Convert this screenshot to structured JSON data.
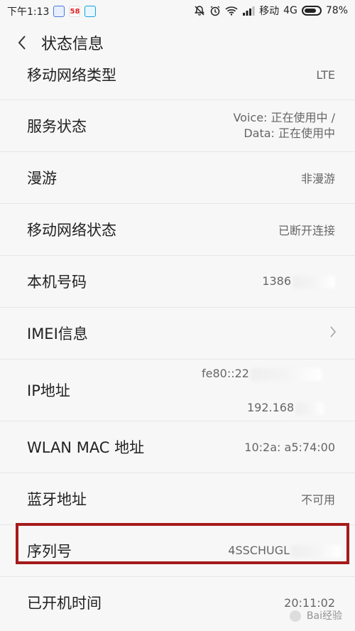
{
  "status_bar": {
    "time": "下午1:13",
    "app_badge": "58",
    "carrier": "移动",
    "network": "4G",
    "battery_percent": "78%",
    "battery_level": 0.78
  },
  "header": {
    "title": "状态信息"
  },
  "rows": [
    {
      "label": "移动网络类型",
      "value": "LTE"
    },
    {
      "label": "服务状态",
      "value_line1": "Voice: 正在使用中 /",
      "value_line2": "Data: 正在使用中"
    },
    {
      "label": "漫游",
      "value": "非漫游"
    },
    {
      "label": "移动网络状态",
      "value": "已断开连接"
    },
    {
      "label": "本机号码",
      "value": "1386"
    },
    {
      "label": "IMEI信息"
    },
    {
      "label": "IP地址",
      "value_line1": "fe80::22",
      "value_line2": "192.168"
    },
    {
      "label": "WLAN MAC 地址",
      "value": "10:2a:  a5:74:00"
    },
    {
      "label": "蓝牙地址",
      "value": "不可用"
    },
    {
      "label": "序列号",
      "value": "4SSCHUGL"
    },
    {
      "label": "已开机时间",
      "value": "20:11:02"
    }
  ],
  "watermark": "Bai经验"
}
